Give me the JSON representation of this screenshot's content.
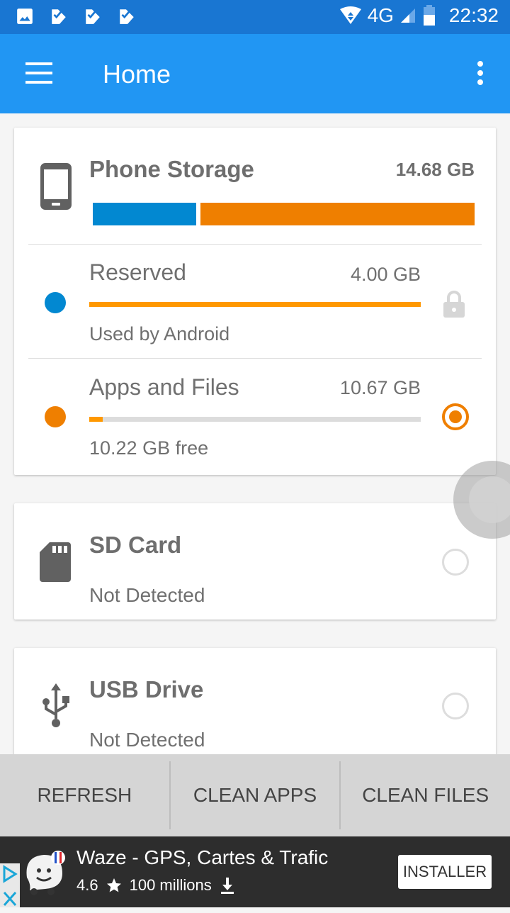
{
  "status_bar": {
    "time": "22:32",
    "network": "4G",
    "left_icons": [
      "image-icon",
      "check-notification-icon",
      "check-notification-icon",
      "check-notification-icon"
    ]
  },
  "app_bar": {
    "title": "Home",
    "menu_icon": "hamburger-menu-icon",
    "overflow_icon": "more-vert-icon"
  },
  "phone_storage": {
    "title": "Phone Storage",
    "total": "14.68 GB",
    "bar_segments": [
      {
        "name": "Reserved",
        "fraction": 0.27,
        "color": "#0288d1"
      },
      {
        "name": "Apps and Files",
        "fraction": 0.73,
        "color": "#ef7f00"
      }
    ],
    "rows": [
      {
        "label": "Reserved",
        "size": "4.00 GB",
        "sub": "Used by Android",
        "dot_color": "#0288d1",
        "bar_fill_percent": 100,
        "trailing": "lock-icon"
      },
      {
        "label": "Apps and Files",
        "size": "10.67 GB",
        "sub": "10.22 GB free",
        "dot_color": "#ef7f00",
        "bar_fill_percent": 4,
        "trailing": "radio-checked"
      }
    ]
  },
  "sd_card": {
    "title": "SD Card",
    "status": "Not Detected",
    "selected": false
  },
  "usb_drive": {
    "title": "USB Drive",
    "status": "Not Detected",
    "selected": false
  },
  "bottom_actions": [
    "REFRESH",
    "CLEAN APPS",
    "CLEAN FILES"
  ],
  "ad": {
    "title": "Waze - GPS, Cartes & Trafic",
    "rating": "4.6",
    "downloads": "100 millions",
    "cta": "INSTALLER"
  },
  "colors": {
    "primary": "#2196f3",
    "primary_dark": "#1976d2",
    "accent": "#ef7f00",
    "blue": "#0288d1"
  }
}
